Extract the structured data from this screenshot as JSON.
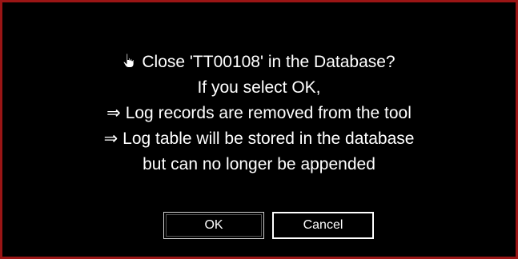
{
  "dialog": {
    "accent_border_color": "#9a1515",
    "background_color": "#000000",
    "icon": "hand-pointer-icon",
    "lines": [
      "Close 'TT00108' in the Database?",
      "If you select OK,",
      "Log records are removed from the tool",
      "Log table will be stored in the database",
      "but can no longer be appended"
    ],
    "arrow_glyph": "⇒"
  },
  "buttons": {
    "ok_label": "OK",
    "cancel_label": "Cancel"
  }
}
